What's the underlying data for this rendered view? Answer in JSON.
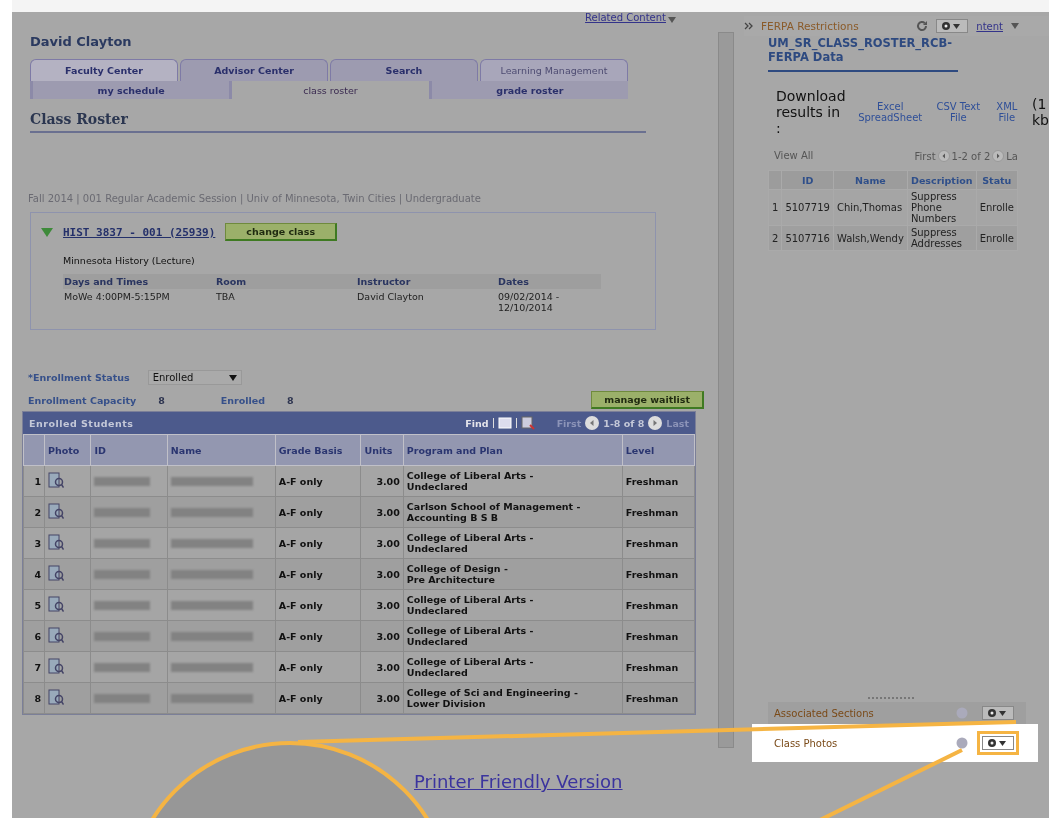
{
  "user_name": "David Clayton",
  "related_content": "Related Content",
  "related_content_right": "ntent",
  "tabs": [
    {
      "label": "Faculty Center",
      "selected": true,
      "disabled": false
    },
    {
      "label": "Advisor Center",
      "selected": false,
      "disabled": false
    },
    {
      "label": "Search",
      "selected": false,
      "disabled": false
    },
    {
      "label": "Learning Management",
      "selected": false,
      "disabled": true
    }
  ],
  "subtabs": [
    {
      "label": "my schedule",
      "selected": false
    },
    {
      "label": "class roster",
      "selected": true
    },
    {
      "label": "grade roster",
      "selected": false
    }
  ],
  "page_title": "Class Roster",
  "term_info": "Fall 2014 | 001 Regular Academic Session | Univ of Minnesota, Twin Cities | Undergraduate",
  "class_section": {
    "expanded": true,
    "link": "HIST 3837 - 001 (25939)",
    "change_button": "change class",
    "description": "Minnesota History (Lecture)",
    "columns": [
      "Days and Times",
      "Room",
      "Instructor",
      "Dates"
    ],
    "row": [
      "MoWe 4:00PM-5:15PM",
      "TBA",
      "David Clayton",
      "09/02/2014 - 12/10/2014"
    ]
  },
  "enrollment": {
    "status_label": "*Enrollment Status",
    "status_value": "Enrolled",
    "capacity_label": "Enrollment Capacity",
    "capacity": "8",
    "enrolled_label": "Enrolled",
    "enrolled": "8",
    "waitlist_button": "manage waitlist"
  },
  "roster": {
    "title": "Enrolled Students",
    "find": "Find",
    "nav_first": "First",
    "range": "1-8 of 8",
    "nav_last": "Last",
    "columns": [
      "",
      "Photo",
      "ID",
      "Name",
      "Grade Basis",
      "Units",
      "Program and Plan",
      "Level"
    ],
    "rows": [
      {
        "number": "1",
        "grade_basis": "A-F only",
        "units": "3.00",
        "program": [
          "College of Liberal Arts -",
          "Undeclared"
        ],
        "level": "Freshman"
      },
      {
        "number": "2",
        "grade_basis": "A-F only",
        "units": "3.00",
        "program": [
          "Carlson School of Management -",
          "Accounting B S B"
        ],
        "level": "Freshman"
      },
      {
        "number": "3",
        "grade_basis": "A-F only",
        "units": "3.00",
        "program": [
          "College of Liberal Arts -",
          "Undeclared"
        ],
        "level": "Freshman"
      },
      {
        "number": "4",
        "grade_basis": "A-F only",
        "units": "3.00",
        "program": [
          "College of Design -",
          "Pre Architecture"
        ],
        "level": "Freshman"
      },
      {
        "number": "5",
        "grade_basis": "A-F only",
        "units": "3.00",
        "program": [
          "College of Liberal Arts -",
          "Undeclared"
        ],
        "level": "Freshman"
      },
      {
        "number": "6",
        "grade_basis": "A-F only",
        "units": "3.00",
        "program": [
          "College of Liberal Arts -",
          "Undeclared"
        ],
        "level": "Freshman"
      },
      {
        "number": "7",
        "grade_basis": "A-F only",
        "units": "3.00",
        "program": [
          "College of Liberal Arts -",
          "Undeclared"
        ],
        "level": "Freshman"
      },
      {
        "number": "8",
        "grade_basis": "A-F only",
        "units": "3.00",
        "program": [
          "College of Sci and Engineering -",
          "Lower Division"
        ],
        "level": "Freshman"
      }
    ]
  },
  "pagelet": {
    "title": "FERPA Restrictions",
    "heading": "UM_SR_CLASS_ROSTER_RCB-FERPA Data",
    "download_label": "Download results in :",
    "formats": [
      "Excel SpreadSheet",
      "CSV Text File",
      "XML File"
    ],
    "size": "(1 kb",
    "view_all": "View All",
    "nav_first": "First",
    "range": "1-2 of 2",
    "nav_last": "La",
    "columns": [
      "",
      "ID",
      "Name",
      "Description",
      "Statu"
    ],
    "rows": [
      [
        "1",
        "5107719",
        "Chin,Thomas",
        "Suppress Phone Numbers",
        "Enrolle"
      ],
      [
        "2",
        "5107716",
        "Walsh,Wendy",
        "Suppress Addresses",
        "Enrolle"
      ]
    ]
  },
  "collapsed_pagelets": [
    {
      "title": "Associated Sections",
      "highlighted": false
    },
    {
      "title": "Class Photos",
      "highlighted": true
    }
  ],
  "printer_link": "Printer Friendly Version"
}
